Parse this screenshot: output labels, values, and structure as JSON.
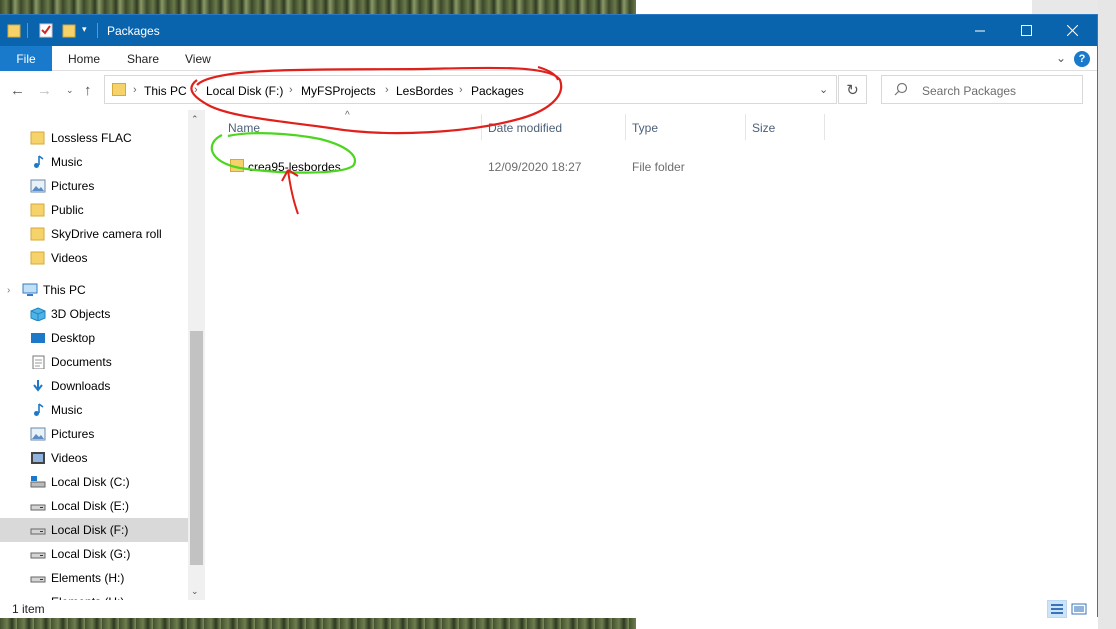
{
  "window": {
    "title": "Packages"
  },
  "ribbon": {
    "file_label": "File",
    "tabs": [
      "Home",
      "Share",
      "View"
    ]
  },
  "address": {
    "crumbs": [
      "This PC",
      "Local Disk (F:)",
      "MyFSProjects",
      "LesBordes",
      "Packages"
    ]
  },
  "search": {
    "placeholder": "Search Packages"
  },
  "nav": {
    "items": [
      {
        "label": "Lossless FLAC",
        "icon": "folder-icon"
      },
      {
        "label": "Music",
        "icon": "music-icon"
      },
      {
        "label": "Pictures",
        "icon": "pictures-icon"
      },
      {
        "label": "Public",
        "icon": "folder-icon"
      },
      {
        "label": "SkyDrive camera roll",
        "icon": "folder-icon"
      },
      {
        "label": "Videos",
        "icon": "folder-icon"
      },
      {
        "label": "This PC",
        "icon": "computer-icon"
      },
      {
        "label": "3D Objects",
        "icon": "cube-icon"
      },
      {
        "label": "Desktop",
        "icon": "desktop-icon"
      },
      {
        "label": "Documents",
        "icon": "documents-icon"
      },
      {
        "label": "Downloads",
        "icon": "downloads-icon"
      },
      {
        "label": "Music",
        "icon": "music-icon"
      },
      {
        "label": "Pictures",
        "icon": "pictures-icon"
      },
      {
        "label": "Videos",
        "icon": "videos-icon"
      },
      {
        "label": "Local Disk (C:)",
        "icon": "system-drive-icon"
      },
      {
        "label": "Local Disk (E:)",
        "icon": "drive-icon"
      },
      {
        "label": "Local Disk (F:)",
        "icon": "drive-icon"
      },
      {
        "label": "Local Disk (G:)",
        "icon": "drive-icon"
      },
      {
        "label": "Elements (H:)",
        "icon": "drive-icon"
      },
      {
        "label": "Elements (H:)",
        "icon": "drive-icon"
      }
    ],
    "selected_index": 16
  },
  "columns": {
    "name": "Name",
    "date": "Date modified",
    "type": "Type",
    "size": "Size"
  },
  "files": [
    {
      "name": "crea95-lesbordes",
      "date": "12/09/2020 18:27",
      "type": "File folder",
      "size": ""
    }
  ],
  "status": {
    "count": "1 item"
  },
  "colors": {
    "titlebar": "#0a64ad",
    "file_tab": "#1979ca",
    "annotation_red": "#e0201a",
    "annotation_green": "#4cd61f"
  }
}
